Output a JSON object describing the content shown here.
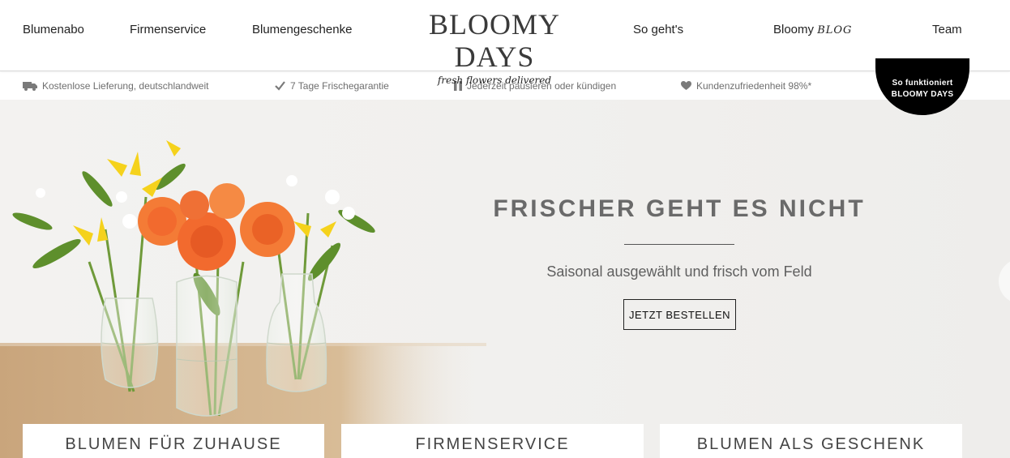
{
  "nav": {
    "left": [
      "Blumenabo",
      "Firmenservice",
      "Blumengeschenke"
    ],
    "logo_title": "BLOOMY DAYS",
    "logo_tagline": "fresh flowers delivered",
    "right": {
      "so_gehts": "So geht's",
      "blog_prefix": "Bloomy",
      "blog_mark": "BLOG",
      "team": "Team"
    }
  },
  "benefits": [
    {
      "icon": "truck-icon",
      "text": "Kostenlose Lieferung, deutschlandweit"
    },
    {
      "icon": "checkmark-icon",
      "text": "7 Tage Frischegarantie"
    },
    {
      "icon": "pause-icon",
      "text": "Jederzeit pausieren oder kündigen"
    },
    {
      "icon": "heart-icon",
      "text": "Kundenzufriedenheit 98%*"
    }
  ],
  "badge": {
    "line1": "So funktioniert",
    "line2": "BLOOMY DAYS"
  },
  "hero": {
    "title": "FRISCHER GEHT ES NICHT",
    "subtitle": "Saisonal ausgewählt und frisch vom Feld",
    "cta": "JETZT BESTELLEN"
  },
  "categories": [
    "BLUMEN FÜR ZUHAUSE",
    "FIRMENSERVICE",
    "BLUMEN ALS GESCHENK"
  ],
  "colors": {
    "accent": "#000000",
    "text": "#222222",
    "muted": "#6e6e6e",
    "orange_rose": "#f26a2e",
    "yellow_lily": "#f5d21c",
    "hero_bg": "#f2f1ef"
  }
}
